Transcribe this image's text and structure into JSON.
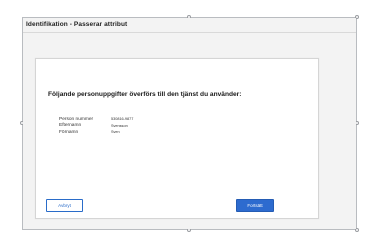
{
  "window": {
    "title": "Identifikation - Passerar attribut"
  },
  "dialog": {
    "heading": "Följande personuppgifter överförs till den tjänst du använder:",
    "fields": [
      {
        "label": "Person nummer",
        "value": "530816-9877"
      },
      {
        "label": "Efternamn",
        "value": "Svensson"
      },
      {
        "label": "Förnamn",
        "value": "Sven"
      }
    ],
    "cancel_label": "Avbryt",
    "continue_label": "Fortsätt"
  },
  "colors": {
    "accent": "#2d6bcf",
    "background": "#f3f3f3",
    "card": "#ffffff"
  }
}
